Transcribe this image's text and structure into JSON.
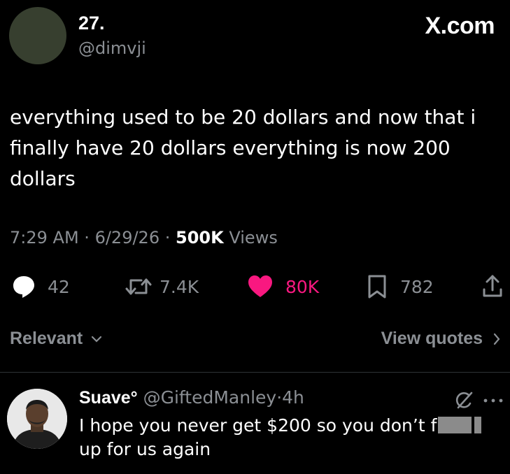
{
  "post": {
    "author_name": "27.",
    "author_handle": "@dimvji",
    "brand": "X.com",
    "text": "everything used to be 20 dollars and now that i finally have 20 dollars everything is now 200 dollars",
    "time": "7:29 AM",
    "date": "6/29/26",
    "views_count": "500K",
    "views_label": "Views",
    "separator": "·"
  },
  "actions": {
    "replies": "42",
    "reposts": "7.4K",
    "likes": "80K",
    "bookmarks": "782"
  },
  "sort": {
    "label": "Relevant",
    "quotes_label": "View quotes"
  },
  "reply": {
    "name": "Suave°",
    "handle": "@GiftedManley",
    "separator": "·",
    "time": "4h",
    "text_before": "I hope you never get $200 so you don’t f",
    "text_after": "up for us again"
  },
  "colors": {
    "background": "#000000",
    "like_pink": "#f91880",
    "muted": "#8b8f94"
  }
}
